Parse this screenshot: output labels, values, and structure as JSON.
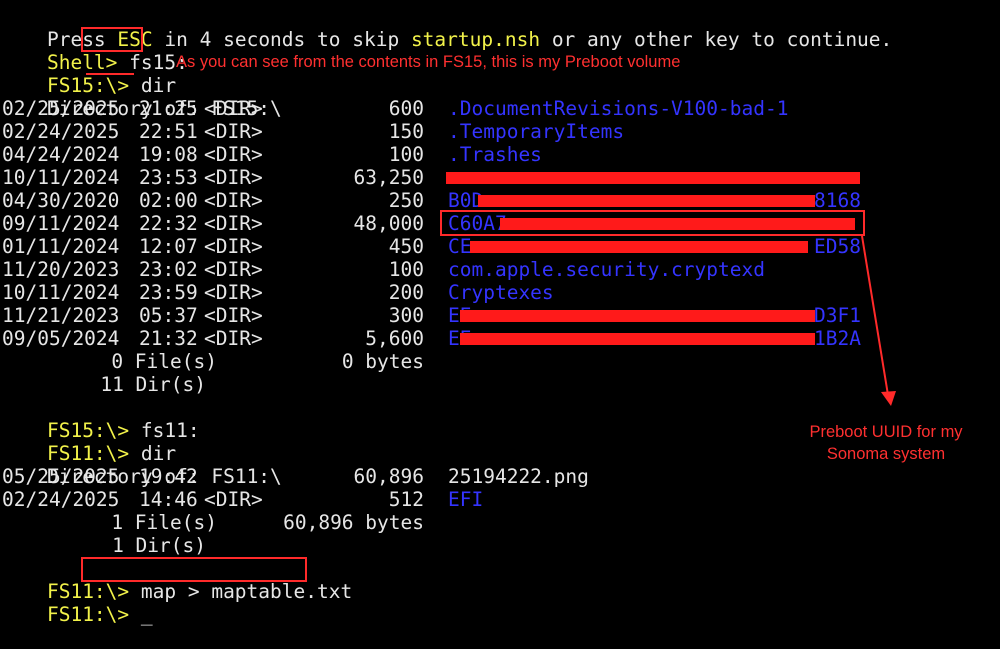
{
  "console": {
    "banner": {
      "pre": "Press ",
      "esc": "ESC",
      "mid1": " in 4 seconds to skip ",
      "file": "startup.nsh",
      "post": " or any other key to continue."
    },
    "cmd1": {
      "prompt": "Shell> ",
      "command": "fs15:"
    },
    "cmd2": {
      "prompt": "FS15:\\> ",
      "command": "dir"
    },
    "dir1_header": {
      "label": "Directory of: ",
      "path": "FS15:\\"
    },
    "dir1_rows": [
      {
        "date": "02/25/2025",
        "time": "21:25",
        "type": "<DIR>",
        "size": "600",
        "name": ".DocumentRevisions-V100-bad-1"
      },
      {
        "date": "02/24/2025",
        "time": "22:51",
        "type": "<DIR>",
        "size": "150",
        "name": ".TemporaryItems"
      },
      {
        "date": "04/24/2024",
        "time": "19:08",
        "type": "<DIR>",
        "size": "100",
        "name": ".Trashes"
      },
      {
        "date": "10/11/2024",
        "time": "23:53",
        "type": "<DIR>",
        "size": "63,250",
        "name": ""
      },
      {
        "date": "04/30/2020",
        "time": "02:00",
        "type": "<DIR>",
        "size": "250",
        "name": "B0D",
        "tail": "8168"
      },
      {
        "date": "09/11/2024",
        "time": "22:32",
        "type": "<DIR>",
        "size": "48,000",
        "name": "C60A7",
        "tail": ""
      },
      {
        "date": "01/11/2024",
        "time": "12:07",
        "type": "<DIR>",
        "size": "450",
        "name": "CE",
        "tail": "ED58"
      },
      {
        "date": "11/20/2023",
        "time": "23:02",
        "type": "<DIR>",
        "size": "100",
        "name": "com.apple.security.cryptexd"
      },
      {
        "date": "10/11/2024",
        "time": "23:59",
        "type": "<DIR>",
        "size": "200",
        "name": "Cryptexes"
      },
      {
        "date": "11/21/2023",
        "time": "05:37",
        "type": "<DIR>",
        "size": "300",
        "name": "EE",
        "tail": "D3F1"
      },
      {
        "date": "09/05/2024",
        "time": "21:32",
        "type": "<DIR>",
        "size": "5,600",
        "name": "EE",
        "tail": "1B2A"
      }
    ],
    "dir1_summary": {
      "files": "0 File(s)",
      "bytes": "0 bytes",
      "dirs": "11 Dir(s)"
    },
    "cmd3": {
      "prompt": "FS15:\\> ",
      "command": "fs11:"
    },
    "cmd4": {
      "prompt": "FS11:\\> ",
      "command": "dir"
    },
    "dir2_header": {
      "label": "Directory of: ",
      "path": "FS11:\\"
    },
    "dir2_rows": [
      {
        "date": "05/25/2025",
        "time": "19:42",
        "type": "",
        "size": "60,896",
        "name": "25194222.png",
        "is_dir": false
      },
      {
        "date": "02/24/2025",
        "time": "14:46",
        "type": "<DIR>",
        "size": "512",
        "name": "EFI",
        "is_dir": true
      }
    ],
    "dir2_summary": {
      "files": "1 File(s)",
      "bytes": "60,896 bytes",
      "dirs": "1 Dir(s)"
    },
    "cmd5": {
      "prompt": "FS11:\\> ",
      "command": "map > maptable.txt"
    },
    "cmd6": {
      "prompt": "FS11:\\> ",
      "cursor": "_"
    }
  },
  "annotations": {
    "preboot_note": "As you can see from the contents in FS15, this is my Preboot volume",
    "uuid_note_line1": "Preboot UUID for my",
    "uuid_note_line2": "Sonoma system"
  },
  "colors": {
    "background": "#000000",
    "prompt": "#f2f24a",
    "text": "#e6e6e6",
    "directory": "#3434ff",
    "annotation": "#ff2a2a"
  }
}
